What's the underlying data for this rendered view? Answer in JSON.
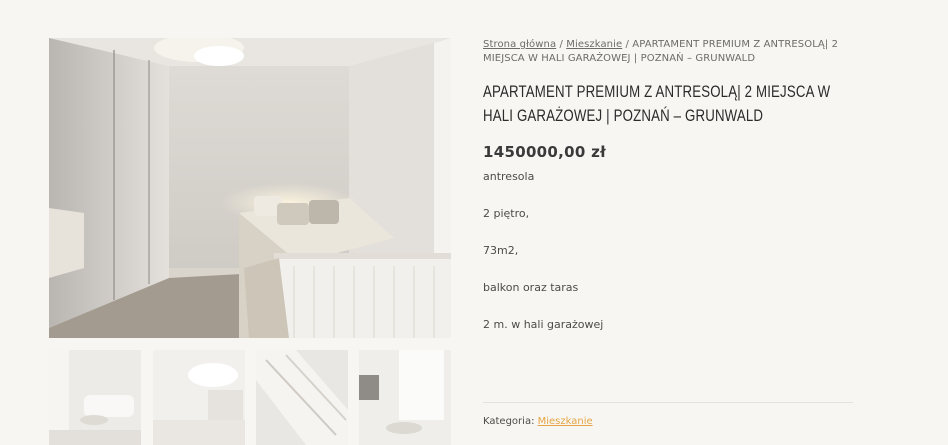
{
  "breadcrumb": {
    "home": "Strona główna",
    "sep1": " / ",
    "category": "Mieszkanie",
    "sep2": " / ",
    "current": "APARTAMENT PREMIUM Z ANTRESOLĄ| 2 MIEJSCA W HALI GARAŻOWEJ | POZNAŃ – GRUNWALD"
  },
  "product": {
    "title": "APARTAMENT PREMIUM Z ANTRESOLĄ| 2 MIEJSCA W HALI GARAŻOWEJ | POZNAŃ – GRUNWALD",
    "price": "1450000,00 zł",
    "description": [
      "antresola",
      "2 piętro,",
      "73m2,",
      "balkon oraz taras",
      "2 m. w hali garażowej"
    ],
    "category_label": "Kategoria: ",
    "category_link": "Mieszkanie"
  },
  "colors": {
    "background": "#f7f6f3",
    "link_accent": "#e6a544",
    "title": "#2b2b2b"
  }
}
